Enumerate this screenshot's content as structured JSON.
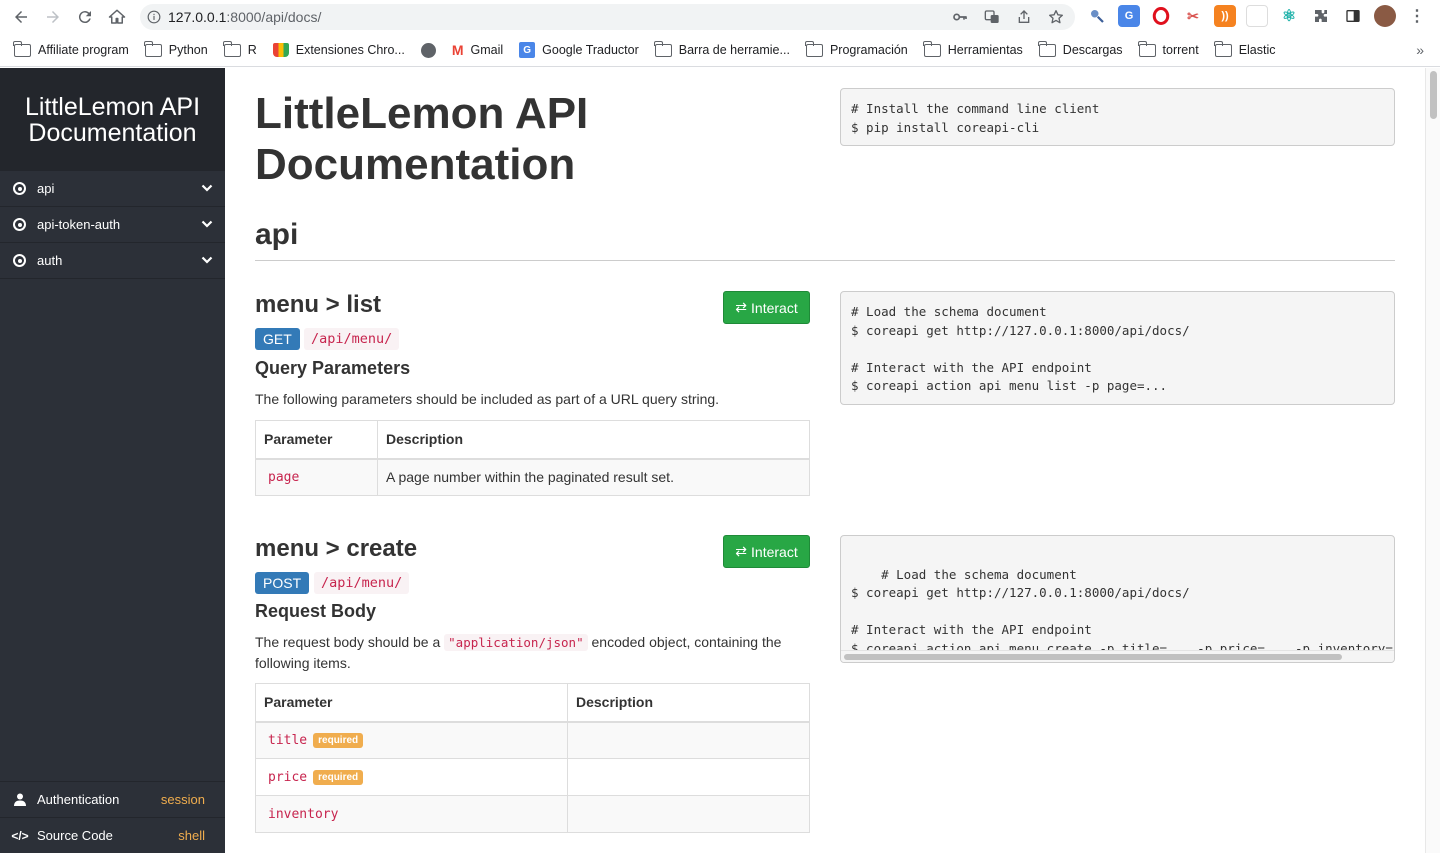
{
  "browser": {
    "url_host": "127.0.0.1",
    "url_rest": ":8000/api/docs/",
    "bookmarks": [
      {
        "label": "Affiliate program",
        "icon": "folder-icon"
      },
      {
        "label": "Python",
        "icon": "folder-icon"
      },
      {
        "label": "R",
        "icon": "folder-icon"
      },
      {
        "label": "Extensiones Chro...",
        "icon": "chrome-web-store-icon"
      },
      {
        "label": "",
        "icon": "globe-icon"
      },
      {
        "label": "Gmail",
        "icon": "gmail-icon"
      },
      {
        "label": "Google Traductor",
        "icon": "google-translate-icon"
      },
      {
        "label": "Barra de herramie...",
        "icon": "folder-icon"
      },
      {
        "label": "Programación",
        "icon": "folder-icon"
      },
      {
        "label": "Herramientas",
        "icon": "folder-icon"
      },
      {
        "label": "Descargas",
        "icon": "folder-icon"
      },
      {
        "label": "torrent",
        "icon": "folder-icon"
      },
      {
        "label": "Elastic",
        "icon": "folder-icon"
      }
    ],
    "more": "»"
  },
  "sidebar": {
    "brand": "LittleLemon API Documentation",
    "items": [
      {
        "label": "api"
      },
      {
        "label": "api-token-auth"
      },
      {
        "label": "auth"
      }
    ],
    "auth_label": "Authentication",
    "auth_value": "session",
    "source_label": "Source Code",
    "source_value": "shell"
  },
  "main": {
    "title": "LittleLemon API Documentation",
    "install_code": "# Install the command line client\n$ pip install coreapi-cli",
    "section": "api",
    "interact_label": "Interact",
    "endpoints": [
      {
        "title": "menu > list",
        "method": "GET",
        "path": "/api/menu/",
        "subhead": "Query Parameters",
        "description": "The following parameters should be included as part of a URL query string.",
        "columns": [
          "Parameter",
          "Description"
        ],
        "rows": [
          {
            "name": "page",
            "required": "",
            "description": "A page number within the paginated result set."
          }
        ],
        "code": "# Load the schema document\n$ coreapi get http://127.0.0.1:8000/api/docs/\n\n# Interact with the API endpoint\n$ coreapi action api menu list -p page=..."
      },
      {
        "title": "menu > create",
        "method": "POST",
        "path": "/api/menu/",
        "subhead": "Request Body",
        "description_pre": "The request body should be a ",
        "description_code": "\"application/json\"",
        "description_post": " encoded object, containing the following items.",
        "columns": [
          "Parameter",
          "Description"
        ],
        "rows": [
          {
            "name": "title",
            "required": "required",
            "description": ""
          },
          {
            "name": "price",
            "required": "required",
            "description": ""
          },
          {
            "name": "inventory",
            "required": "",
            "description": ""
          }
        ],
        "code": "# Load the schema document\n$ coreapi get http://127.0.0.1:8000/api/docs/\n\n# Interact with the API endpoint\n$ coreapi action api menu create -p title=... -p price=... -p inventory=..."
      }
    ]
  },
  "colors": {
    "sidebar_bg": "#2c3038",
    "brand_bg": "#23262c",
    "interact_green": "#28a745",
    "method_blue": "#337ab7",
    "code_red": "#c7254e",
    "required_orange": "#f0ad4e"
  }
}
